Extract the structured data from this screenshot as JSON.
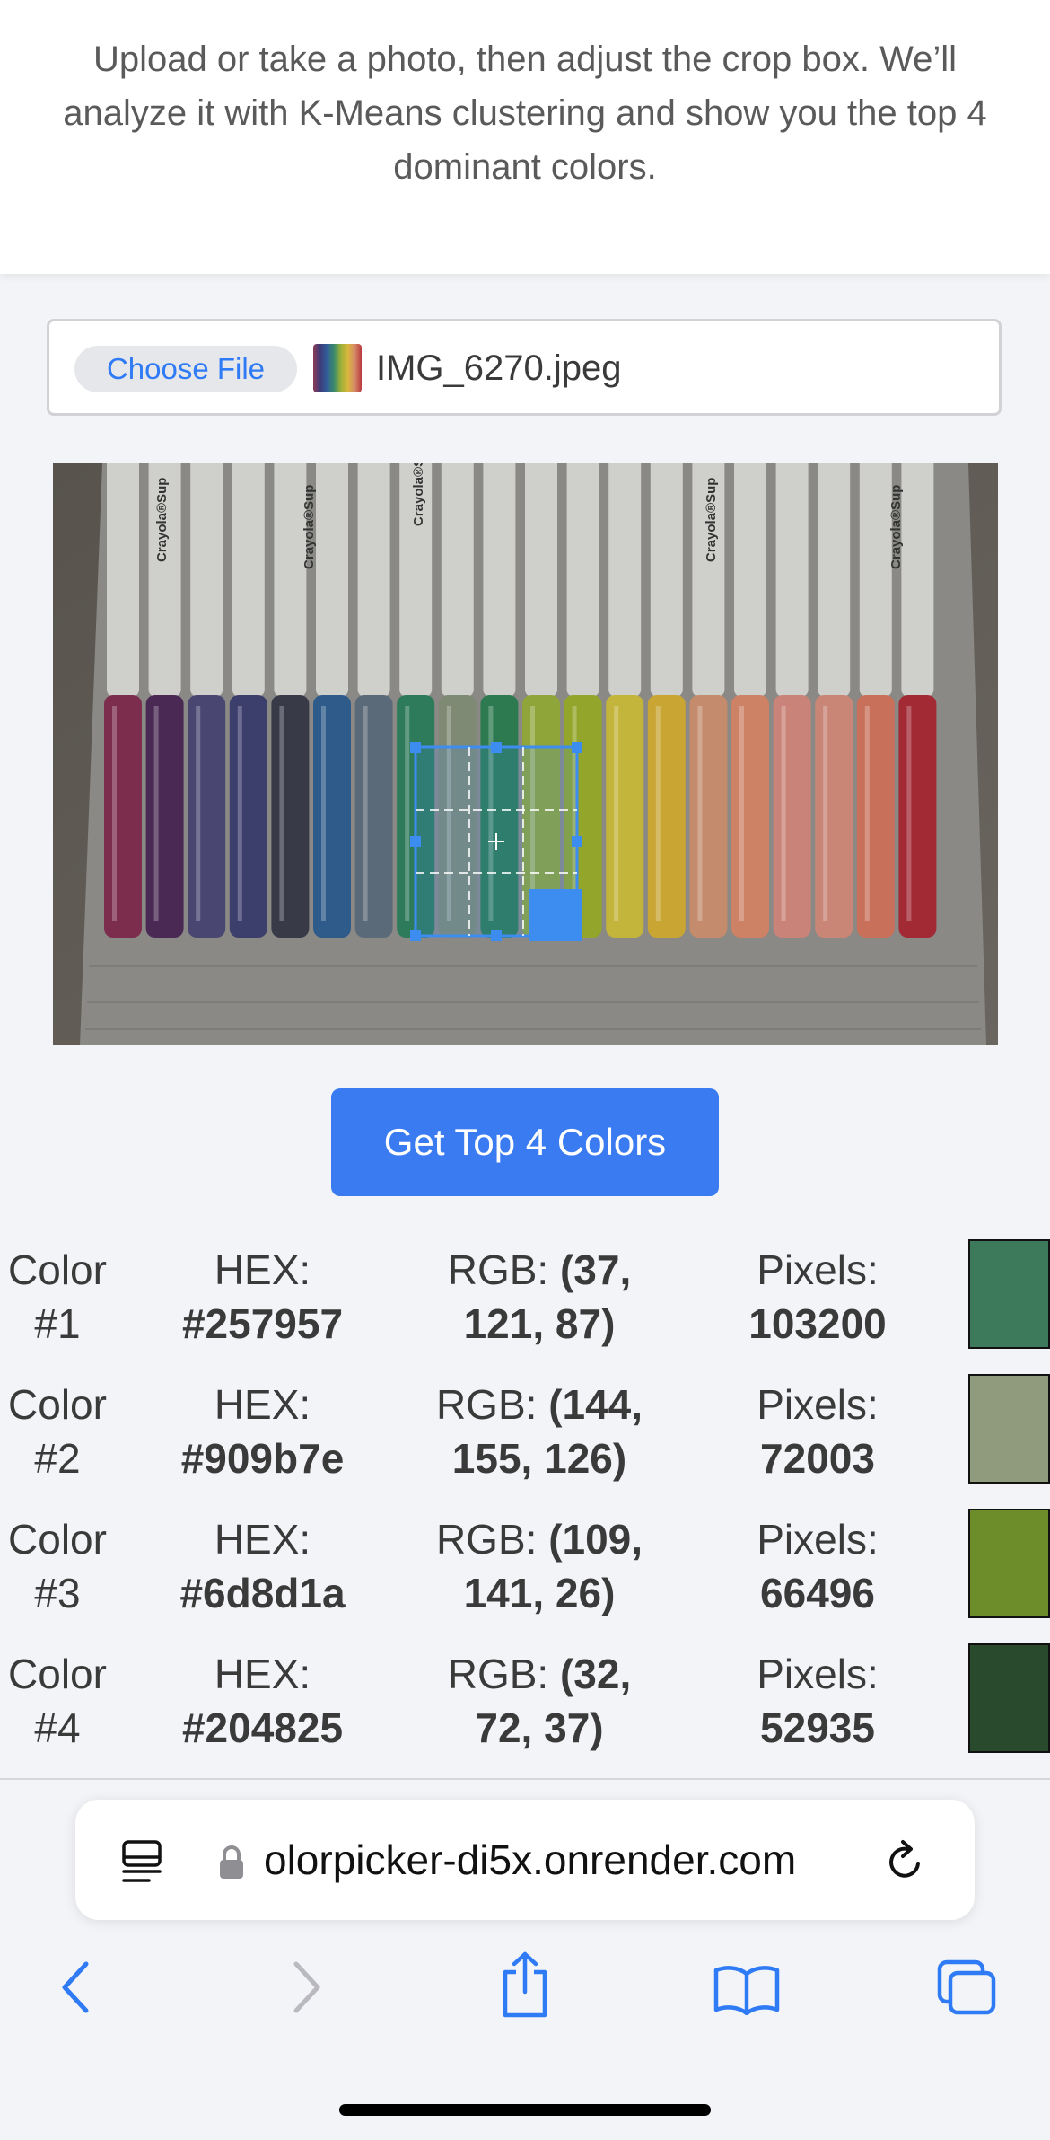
{
  "intro": {
    "text": "Upload or take a photo, then adjust the crop box. We’ll analyze it with K-Means clustering and show you the top 4 dominant colors."
  },
  "file_input": {
    "button_label": "Choose File",
    "file_name": "IMG_6270.jpeg"
  },
  "photo": {
    "marker_labels": [
      "Crayola®Sup",
      "Crayola®Sup",
      "Crayola®Sup",
      "Crayola®Sup",
      "Crayola®Sup"
    ]
  },
  "action": {
    "label": "Get Top 4 Colors"
  },
  "colors": [
    {
      "label": "Color #1",
      "hex_label": "HEX:",
      "hex": "#257957",
      "rgb_label": "RGB:",
      "rgb": "(37, 121, 87)",
      "pixels_label": "Pixels:",
      "pixels": "103200",
      "swatch": "#3d7a5c"
    },
    {
      "label": "Color #2",
      "hex_label": "HEX:",
      "hex": "#909b7e",
      "rgb_label": "RGB:",
      "rgb": "(144, 155, 126)",
      "pixels_label": "Pixels:",
      "pixels": "72003",
      "swatch": "#909b7e"
    },
    {
      "label": "Color #3",
      "hex_label": "HEX:",
      "hex": "#6d8d1a",
      "rgb_label": "RGB:",
      "rgb": "(109, 141, 26)",
      "pixels_label": "Pixels:",
      "pixels": "66496",
      "swatch": "#6d8d2a"
    },
    {
      "label": "Color #4",
      "hex_label": "HEX:",
      "hex": "#204825",
      "rgb_label": "RGB:",
      "rgb": "(32, 72, 37)",
      "pixels_label": "Pixels:",
      "pixels": "52935",
      "swatch": "#2a4a2e"
    }
  ],
  "browser": {
    "url": "olorpicker-di5x.onrender.com",
    "icons": [
      "reader-icon",
      "lock-icon",
      "reload-icon",
      "back-icon",
      "forward-icon",
      "share-icon",
      "bookmarks-icon",
      "tabs-icon"
    ]
  },
  "theme": {
    "accent": "#3a7bf2",
    "crop": "#3d8cf0"
  }
}
